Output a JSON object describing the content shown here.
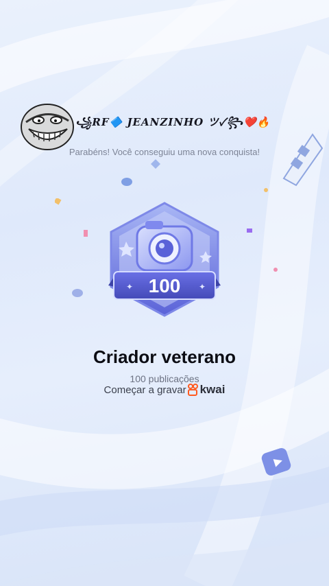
{
  "header": {
    "username": "꧁RF🔷   JEANZINHO ツ✓꧂❤️🔥",
    "congrats_text": "Parabéns! Você conseguiu uma nova conquista!"
  },
  "badge": {
    "count": "100"
  },
  "achievement": {
    "title": "Criador veterano",
    "subtitle": "100 publicações",
    "record_label": "Começar a gravar",
    "brand": "kwai"
  },
  "colors": {
    "accent_purple": "#5a5fd6",
    "brand_orange": "#ff5a1f"
  }
}
